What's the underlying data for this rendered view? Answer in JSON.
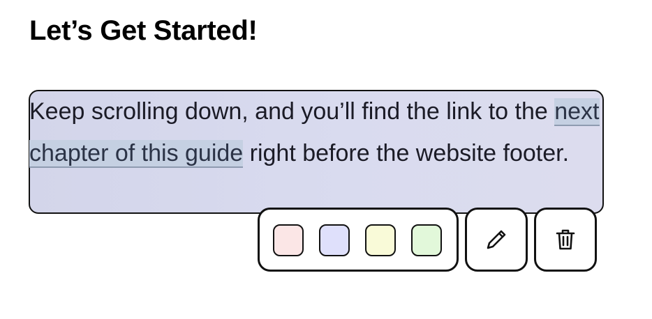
{
  "heading": "Let’s Get Started!",
  "paragraph": {
    "before_link": "Keep scrolling down, and you’ll find the link to the ",
    "link_text": "next chapter of this guide",
    "after_link": " right before the website footer."
  },
  "highlight_toolbar": {
    "swatches": [
      {
        "name": "pink",
        "color": "#fbe6e6"
      },
      {
        "name": "lavender",
        "color": "#dfe0fb"
      },
      {
        "name": "yellow",
        "color": "#f9fad8"
      },
      {
        "name": "green",
        "color": "#e2f8da"
      }
    ],
    "edit_icon": "pencil-icon",
    "delete_icon": "trash-icon"
  },
  "colors": {
    "highlight_fill": "#d7d9ee",
    "link_fill": "#c5d0e2",
    "border": "#111111"
  }
}
